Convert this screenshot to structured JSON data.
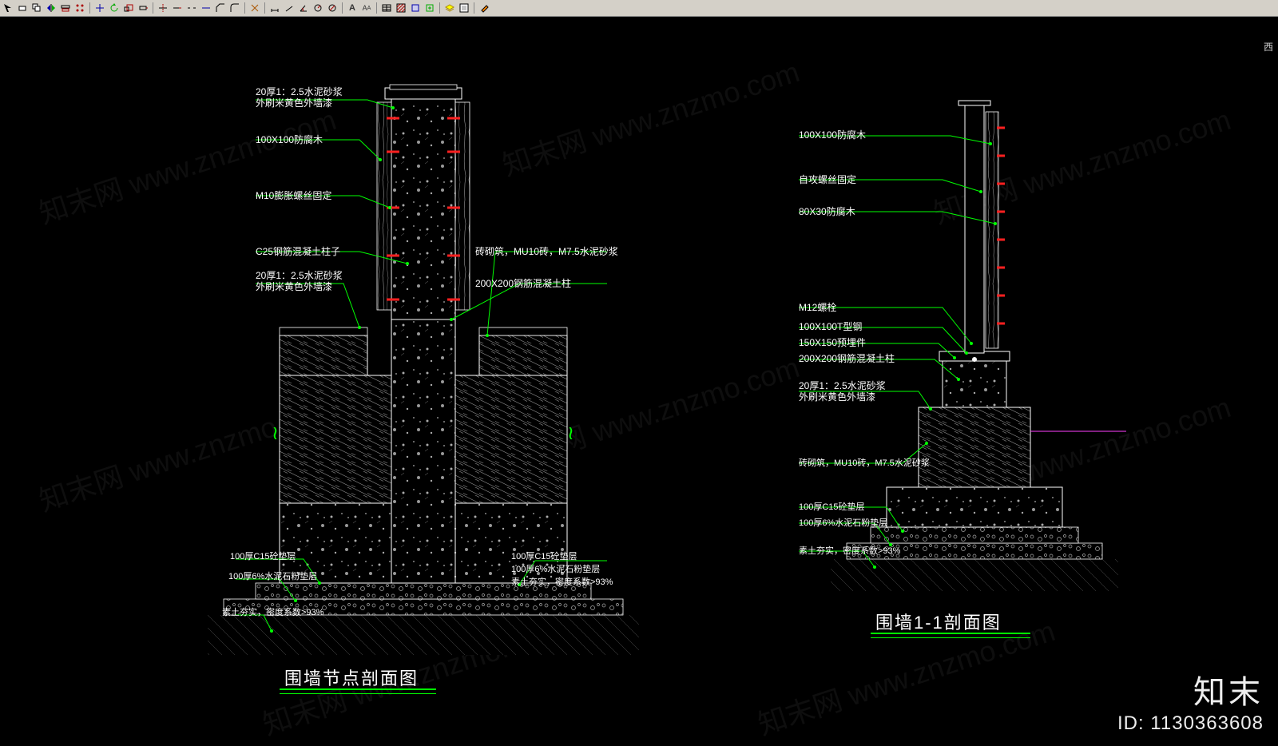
{
  "titles": {
    "left": "围墙节点剖面图",
    "right": "围墙1-1剖面图"
  },
  "brand": {
    "logo": "知末",
    "id_label": "ID: 1130363608"
  },
  "watermark_text": "知末网 www.znzmo.com",
  "status_right": "西",
  "left_annotations": {
    "a1_l1": "20厚1：2.5水泥砂浆",
    "a1_l2": "外刷米黄色外墙漆",
    "a2": "100X100防腐木",
    "a3": "M10膨胀螺丝固定",
    "a4": "C25钢筋混凝土柱子",
    "a5_l1": "20厚1：2.5水泥砂浆",
    "a5_l2": "外刷米黄色外墙漆",
    "r1": "砖砌筑，MU10砖，M7.5水泥砂浆",
    "r2": "200X200钢筋混凝土柱",
    "b_left1": "100厚C15砼垫层",
    "b_left2": "100厚6%水泥石粉垫层",
    "b_left3": "素土夯实，密度系数>93%",
    "b_right1": "100厚C15砼垫层",
    "b_right2": "100厚6%水泥石粉垫层",
    "b_right3": "素土夯实，密度系数>93%"
  },
  "right_annotations": {
    "a1": "100X100防腐木",
    "a2": "自攻螺丝固定",
    "a3": "80X30防腐木",
    "a4": "M12螺栓",
    "a5": "100X100T型钢",
    "a6": "150X150预埋件",
    "a7": "200X200钢筋混凝土柱",
    "a8_l1": "20厚1：2.5水泥砂浆",
    "a8_l2": "外刷米黄色外墙漆",
    "b1": "砖砌筑，MU10砖，M7.5水泥砂浆",
    "b2": "100厚C15砼垫层",
    "b3": "100厚6%水泥石粉垫层",
    "b4": "素土夯实，密度系数>93%"
  }
}
